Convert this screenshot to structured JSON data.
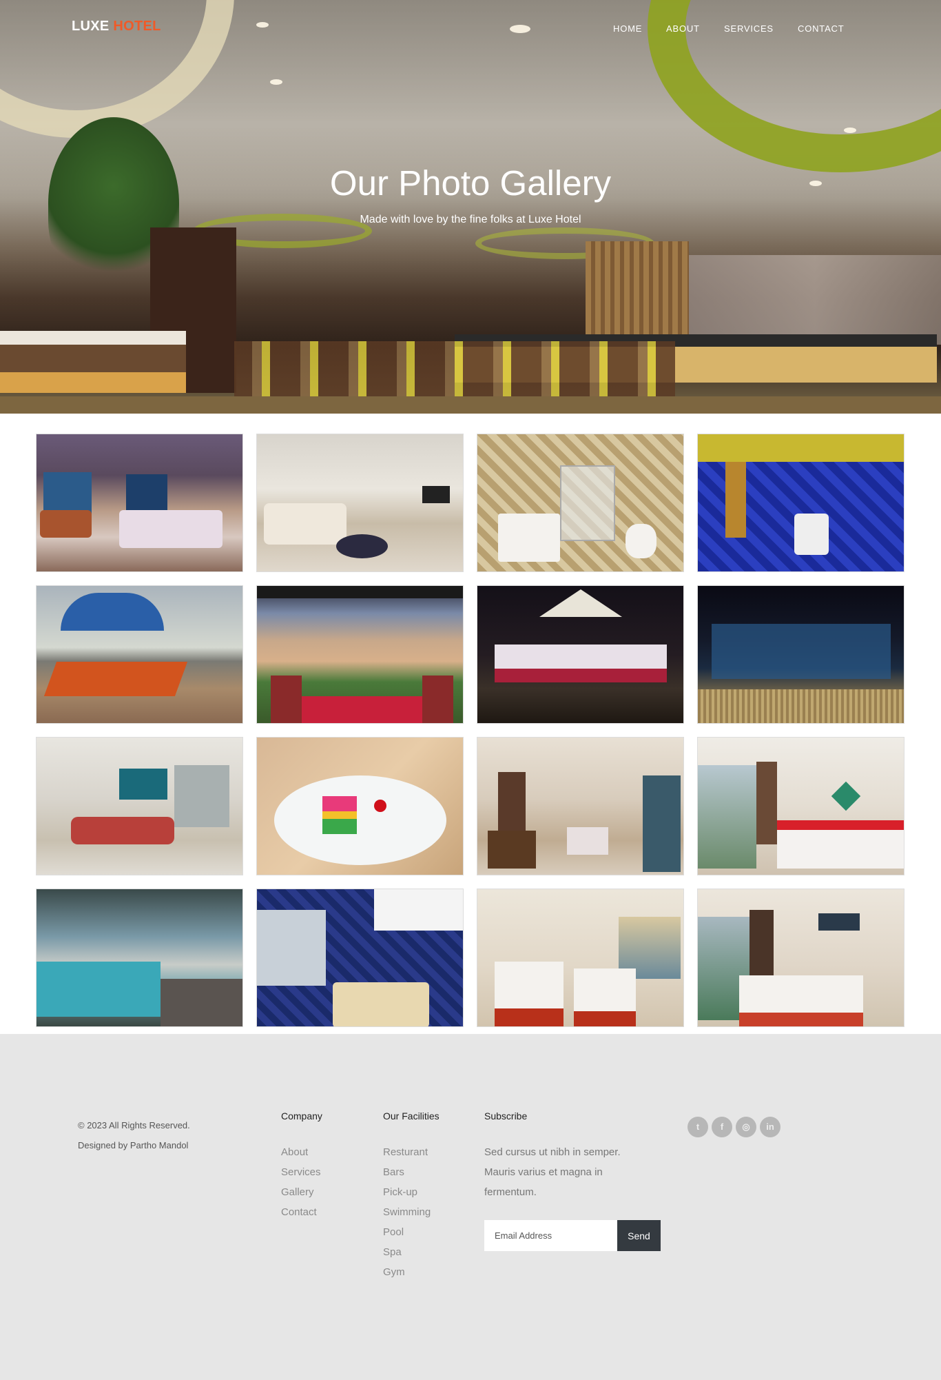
{
  "brand": {
    "name_part1": "LUXE",
    "name_part2": "HOTEL",
    "accent_color": "#f05a28"
  },
  "nav": {
    "items": [
      {
        "label": "HOME"
      },
      {
        "label": "ABOUT"
      },
      {
        "label": "SERVICES"
      },
      {
        "label": "CONTACT"
      }
    ]
  },
  "hero": {
    "title": "Our Photo Gallery",
    "subtitle": "Made with love by the fine folks at Luxe Hotel"
  },
  "gallery": {
    "photos": [
      {
        "subject": "suite-bedroom-ocean-view"
      },
      {
        "subject": "living-room-sofa"
      },
      {
        "subject": "bathroom-jacuzzi-gold-tile"
      },
      {
        "subject": "bathroom-blue-tile"
      },
      {
        "subject": "beach-umbrella-loungers"
      },
      {
        "subject": "outdoor-dining-table"
      },
      {
        "subject": "night-event-gazebo"
      },
      {
        "subject": "stage-concert"
      },
      {
        "subject": "cafe-lounge"
      },
      {
        "subject": "dessert-plate"
      },
      {
        "subject": "suite-sitting-area"
      },
      {
        "subject": "bedroom-red-bed"
      },
      {
        "subject": "terrace-pool-sea-view"
      },
      {
        "subject": "bathroom-marble-basin"
      },
      {
        "subject": "twin-bedroom-sunset"
      },
      {
        "subject": "bedroom-towel-swans"
      }
    ]
  },
  "footer": {
    "copyright": "© 2023 All Rights Reserved.",
    "designer": "Designed by Partho Mandol",
    "company": {
      "heading": "Company",
      "links": [
        {
          "label": "About"
        },
        {
          "label": "Services"
        },
        {
          "label": "Gallery"
        },
        {
          "label": "Contact"
        }
      ]
    },
    "facilities": {
      "heading": "Our Facilities",
      "links": [
        {
          "label": "Resturant"
        },
        {
          "label": "Bars"
        },
        {
          "label": "Pick-up"
        },
        {
          "label": "Swimming"
        },
        {
          "label": "Pool"
        },
        {
          "label": "Spa"
        },
        {
          "label": "Gym"
        }
      ]
    },
    "subscribe": {
      "heading": "Subscribe",
      "text": "Sed cursus ut nibh in semper. Mauris varius et magna in fermentum.",
      "email_placeholder": "Email Address",
      "send_label": "Send"
    },
    "social": [
      {
        "icon": "twitter-icon",
        "glyph": "t"
      },
      {
        "icon": "facebook-icon",
        "glyph": "f"
      },
      {
        "icon": "instagram-icon",
        "glyph": "◎"
      },
      {
        "icon": "linkedin-icon",
        "glyph": "in"
      }
    ]
  }
}
